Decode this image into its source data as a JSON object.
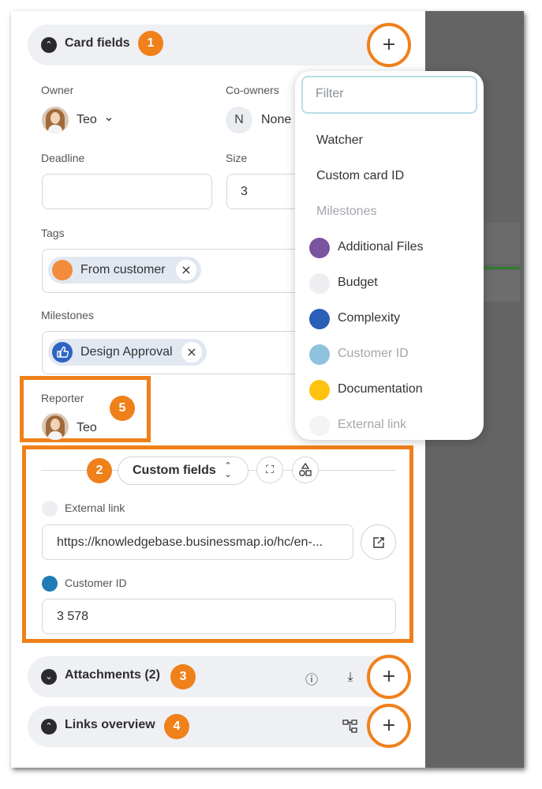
{
  "card_fields": {
    "title": "Card fields",
    "badge": "1",
    "add_symbol": "+",
    "owner_label": "Owner",
    "owner_name": "Teo",
    "owner_caret": "⌄",
    "coowners_label": "Co-owners",
    "coowners_initial": "N",
    "coowners_value": "None",
    "deadline_label": "Deadline",
    "deadline_value": "",
    "size_label": "Size",
    "size_value": "3",
    "tags_label": "Tags",
    "tag": {
      "label": "From customer",
      "color": "#f28c3a"
    },
    "milestones_label": "Milestones",
    "milestone": {
      "label": "Design Approval",
      "icon": "thumbs-up-icon",
      "color": "#2d64c4"
    },
    "reporter_label": "Reporter",
    "reporter_name": "Teo",
    "reporter_badge": "5",
    "close_symbol": "×"
  },
  "dropdown": {
    "filter_placeholder": "Filter",
    "items": [
      {
        "label": "Watcher",
        "dot": null,
        "muted": false
      },
      {
        "label": "Custom card ID",
        "dot": null,
        "muted": false
      },
      {
        "label": "Milestones",
        "dot": null,
        "muted": true
      },
      {
        "label": "Additional Files",
        "dot": "#7b53a0",
        "muted": false
      },
      {
        "label": "Budget",
        "dot": "#eceef1",
        "muted": false
      },
      {
        "label": "Complexity",
        "dot": "#2a5fb8",
        "muted": false
      },
      {
        "label": "Customer ID",
        "dot": "#8fc2dd",
        "muted": true
      },
      {
        "label": "Documentation",
        "dot": "#ffc20e",
        "muted": false
      },
      {
        "label": "External link",
        "dot": "#f3f4f6",
        "muted": true
      }
    ]
  },
  "custom_fields": {
    "badge": "2",
    "toggle_label": "Custom fields",
    "toggle_icon": "⌃⌄",
    "expand_icon": "⛶",
    "shapes_icon": "⟁",
    "external_link_label": "External link",
    "external_link_dot": "#eceef1",
    "external_link_value": "https://knowledgebase.businessmap.io/hc/en-...",
    "open_link_icon": "↗",
    "customer_id_label": "Customer ID",
    "customer_id_dot": "#1f7bb5",
    "customer_id_value": "3 578"
  },
  "attachments": {
    "title": "Attachments (2)",
    "badge": "3",
    "info_icon": "ⓘ",
    "download_icon": "⤓",
    "add_symbol": "+"
  },
  "links_overview": {
    "title": "Links overview",
    "badge": "4",
    "tree_icon": "⊞",
    "add_symbol": "+"
  },
  "colors": {
    "accent_orange": "#f0801a",
    "section_bg": "#eef0f4",
    "chip_bg": "#e2e8f2"
  }
}
